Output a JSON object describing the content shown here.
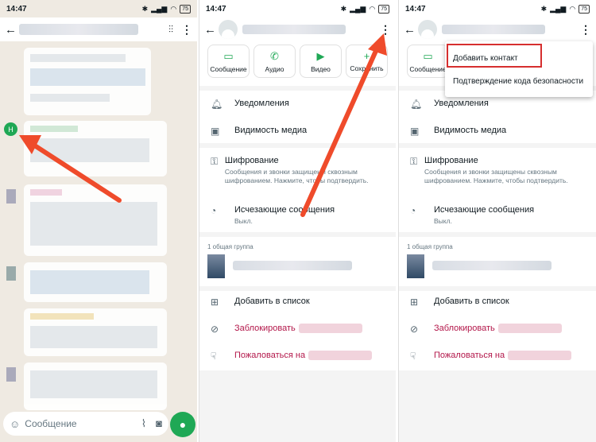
{
  "status": {
    "time": "14:47",
    "battery": "75"
  },
  "chat": {
    "avatar_letter": "H",
    "compose_placeholder": "Сообщение",
    "icons": [
      "back-arrow-icon",
      "waveform-icon",
      "kebab-menu-icon",
      "sticker-icon",
      "paperclip-icon",
      "camera-icon",
      "mic-icon"
    ]
  },
  "info": {
    "actions": [
      {
        "label": "Сообщение",
        "icon": "message-icon"
      },
      {
        "label": "Аудио",
        "icon": "phone-icon"
      },
      {
        "label": "Видео",
        "icon": "video-icon"
      },
      {
        "label": "Сохранить",
        "icon": "save-icon"
      }
    ],
    "notifications": "Уведомления",
    "media_visibility": "Видимость медиа",
    "encryption": "Шифрование",
    "encryption_sub": "Сообщения и звонки защищены сквозным шифрованием. Нажмите, чтобы подтвердить.",
    "disappearing": "Исчезающие сообщения",
    "disappearing_sub": "Выкл.",
    "group_header": "1 общая группа",
    "add_to_list": "Добавить в список",
    "block": "Заблокировать",
    "report": "Пожаловаться на"
  },
  "menu": {
    "add_contact": "Добавить контакт",
    "security_code": "Подтверждение кода безопасности"
  },
  "colors": {
    "accent": "#1fa855",
    "danger": "#b3174a",
    "highlight": "#d62f2f",
    "arrow": "#ef4b2b"
  }
}
